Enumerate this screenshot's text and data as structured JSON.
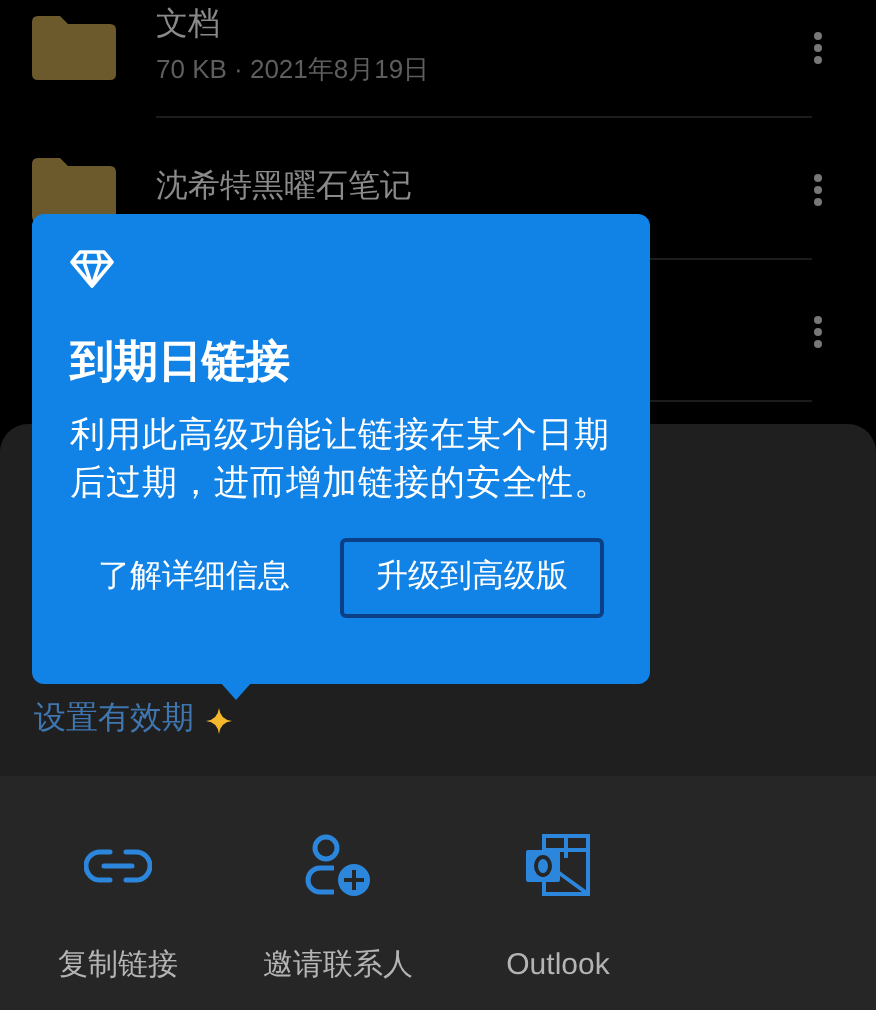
{
  "files": [
    {
      "name": "文档",
      "meta": "70 KB · 2021年8月19日",
      "folder": true,
      "menu": true
    },
    {
      "name": "沈希特黑曜石笔记",
      "folder": true,
      "menu": true
    },
    {
      "menu": true
    }
  ],
  "popup": {
    "title": "到期日链接",
    "body": "利用此高级功能让链接在某个日期后过期，进而增加链接的安全性。",
    "buttons": [
      {
        "label": "了解详细信息",
        "kind": "text"
      },
      {
        "label": "升级到高级版",
        "kind": "outlined"
      }
    ]
  },
  "expiry_link": "设置有效期",
  "share_targets": [
    {
      "label": "复制链接",
      "kind": "link"
    },
    {
      "label": "邀请联系人",
      "kind": "contact"
    },
    {
      "label": "Outlook",
      "kind": "outlook"
    }
  ]
}
